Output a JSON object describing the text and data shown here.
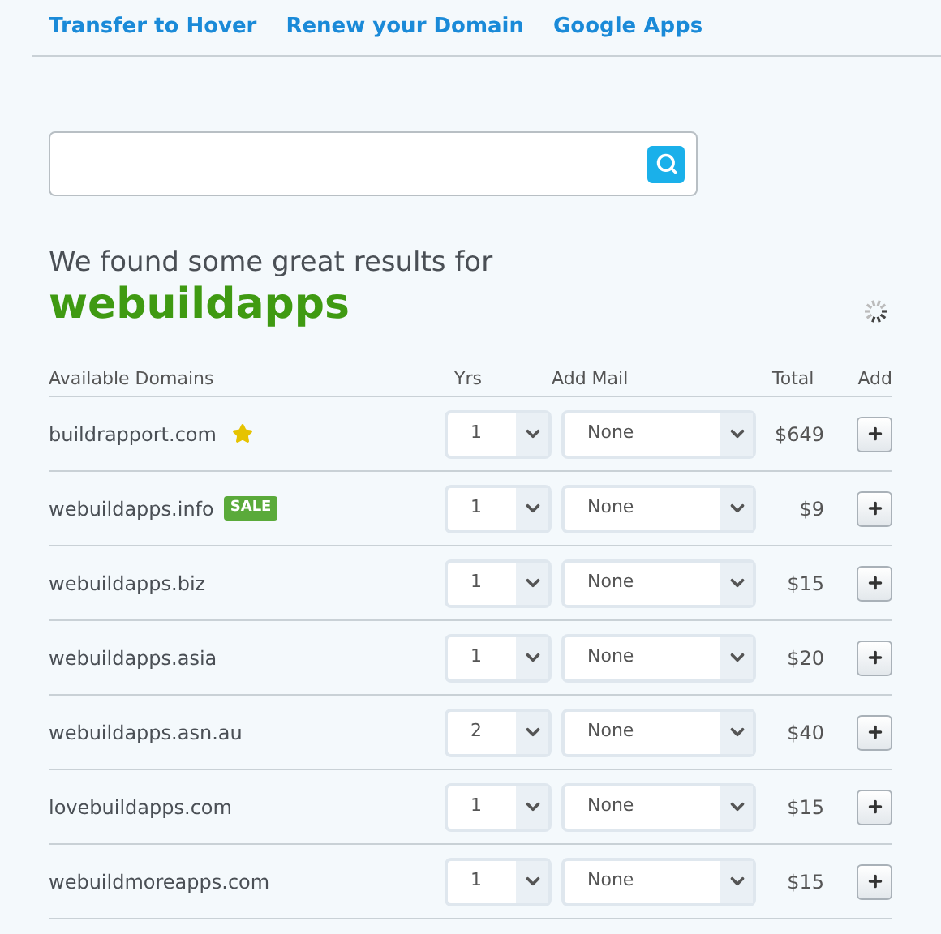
{
  "nav": [
    {
      "label": "Transfer to Hover"
    },
    {
      "label": "Renew your Domain"
    },
    {
      "label": "Google Apps"
    }
  ],
  "results_intro": "We found some great results for",
  "query": "webuildapps",
  "table": {
    "columns": [
      "Available Domains",
      "Yrs",
      "Add Mail",
      "Total",
      "Add"
    ],
    "rows": [
      {
        "domain": "buildrapport.com",
        "starred": true,
        "years": "1",
        "mail": "None",
        "total": "$649"
      },
      {
        "domain": "webuildapps.info",
        "starred": false,
        "badge": "SALE",
        "years": "1",
        "mail": "None",
        "total": "$9"
      },
      {
        "domain": "webuildapps.biz",
        "starred": false,
        "years": "1",
        "mail": "None",
        "total": "$15"
      },
      {
        "domain": "webuildapps.asia",
        "starred": false,
        "years": "1",
        "mail": "None",
        "total": "$20"
      },
      {
        "domain": "webuildapps.asn.au",
        "starred": false,
        "years": "2",
        "mail": "None",
        "total": "$40"
      },
      {
        "domain": "lovebuildapps.com",
        "starred": false,
        "years": "1",
        "mail": "None",
        "total": "$15"
      },
      {
        "domain": "webuildmoreapps.com",
        "starred": false,
        "years": "1",
        "mail": "None",
        "total": "$15"
      }
    ]
  }
}
